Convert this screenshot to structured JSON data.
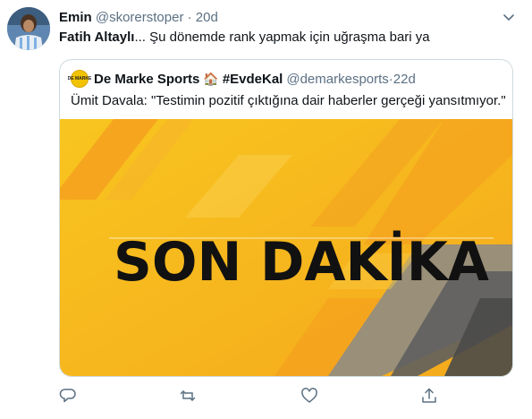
{
  "tweet": {
    "display_name": "Emin",
    "handle": "@skorerstoper",
    "separator": "·",
    "time": "20d",
    "text_bold": "Fatih Altaylı",
    "text_rest": "... Şu dönemde rank yapmak için uğraşma bari ya"
  },
  "quoted": {
    "display_name": "De Marke Sports",
    "house_icon": "🏠",
    "hashtag": "#EvdeKal",
    "handle": "@demarkesports",
    "separator": "·",
    "time": "22d",
    "text": "Ümit Davala: \"Testimin pozitif çıktığına dair haberler gerçeği yansıtmıyor.\"",
    "image_headline": "SON DAKİKA",
    "avatar_text": "DE MARKE"
  },
  "colors": {
    "banner_yellow": "#f6b81c",
    "banner_orange": "#f39a1e",
    "banner_gray": "#6e6e6e",
    "icon_gray": "#5b7083"
  },
  "icons": [
    "reply-icon",
    "retweet-icon",
    "like-icon",
    "share-icon",
    "caret-down-icon"
  ]
}
